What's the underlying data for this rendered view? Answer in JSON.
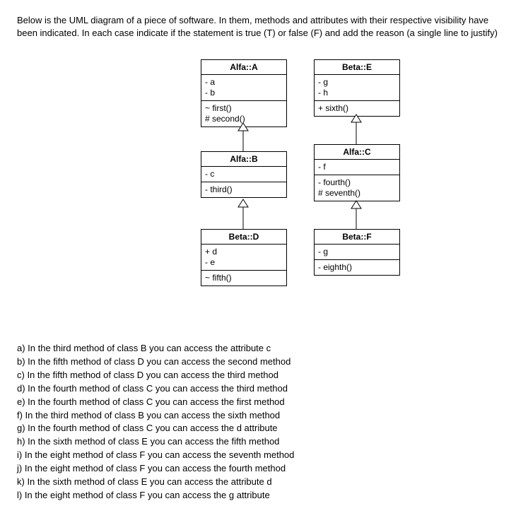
{
  "intro": "Below is the UML diagram of a piece of software. In them, methods and attributes with their respective visibility have been indicated. In each case indicate if the statement is true (T) or false (F) and add the reason (a single line to justify)",
  "classes": {
    "A": {
      "name": "Alfa::A",
      "attrs": [
        "- a",
        "- b"
      ],
      "ops": [
        "~ first()",
        "# second()"
      ]
    },
    "B": {
      "name": "Alfa::B",
      "attrs": [
        "- c"
      ],
      "ops": [
        "- third()"
      ]
    },
    "D": {
      "name": "Beta::D",
      "attrs": [
        "+ d",
        "- e"
      ],
      "ops": [
        "~ fifth()"
      ]
    },
    "E": {
      "name": "Beta::E",
      "attrs": [
        "- g",
        "- h"
      ],
      "ops": [
        "+ sixth()"
      ]
    },
    "C": {
      "name": "Alfa::C",
      "attrs": [
        "- f"
      ],
      "ops": [
        "- fourth()",
        "# seventh()"
      ]
    },
    "F": {
      "name": "Beta::F",
      "attrs": [
        "- g"
      ],
      "ops": [
        "- eighth()"
      ]
    }
  },
  "questions": {
    "a": "a) In the third method of class B you can access the attribute c",
    "b": "b) In the fifth method of class D you can access the second method",
    "c": "c) In the fifth method of class D you can access the third method",
    "d": "d) In the fourth method of class C you can access the third method",
    "e": "e) In the fourth method of class C you can access the first method",
    "f": "f) In the third method of class B you can access the sixth method",
    "g": "g) In the fourth method of class C you can access the d attribute",
    "h": "h) In the sixth method of class E you can access the fifth method",
    "i": "i) In the eight method of class F you can access the seventh method",
    "j": "j) In the eight method of class F you can access the fourth method",
    "k": "k) In the sixth method of class E you can access the attribute d",
    "l": "l) In the eight method of class F you can access the g attribute"
  }
}
